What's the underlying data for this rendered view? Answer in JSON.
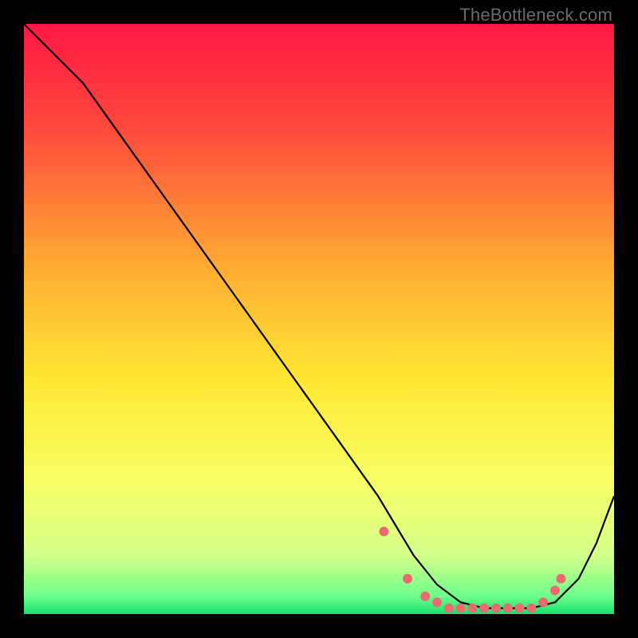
{
  "watermark": "TheBottleneck.com",
  "chart_data": {
    "type": "line",
    "title": "",
    "xlabel": "",
    "ylabel": "",
    "xlim": [
      0,
      100
    ],
    "ylim": [
      0,
      100
    ],
    "grid": false,
    "legend": false,
    "gradient_stops": [
      {
        "offset": 0,
        "color": "#ff1744"
      },
      {
        "offset": 18,
        "color": "#ff4a3d"
      },
      {
        "offset": 40,
        "color": "#ffa733"
      },
      {
        "offset": 60,
        "color": "#ffe733"
      },
      {
        "offset": 78,
        "color": "#f7ff66"
      },
      {
        "offset": 90,
        "color": "#d4ff8a"
      },
      {
        "offset": 97,
        "color": "#6dff8a"
      },
      {
        "offset": 100,
        "color": "#18e06b"
      }
    ],
    "curve": {
      "x": [
        0,
        6,
        10,
        15,
        20,
        25,
        30,
        35,
        40,
        45,
        50,
        55,
        60,
        63,
        66,
        70,
        74,
        78,
        82,
        86,
        90,
        94,
        97,
        100
      ],
      "y": [
        100,
        94,
        90,
        83,
        76,
        69,
        62,
        55,
        48,
        41,
        34,
        27,
        20,
        15,
        10,
        5,
        2,
        1,
        1,
        1,
        2,
        6,
        12,
        20
      ]
    },
    "markers": {
      "x": [
        61,
        65,
        68,
        70,
        72,
        74,
        76,
        78,
        80,
        82,
        84,
        86,
        88,
        90,
        91
      ],
      "y": [
        14,
        6,
        3,
        2,
        1,
        1,
        1,
        1,
        1,
        1,
        1,
        1,
        2,
        4,
        6
      ],
      "color": "#e96a6f",
      "size": 6
    }
  }
}
